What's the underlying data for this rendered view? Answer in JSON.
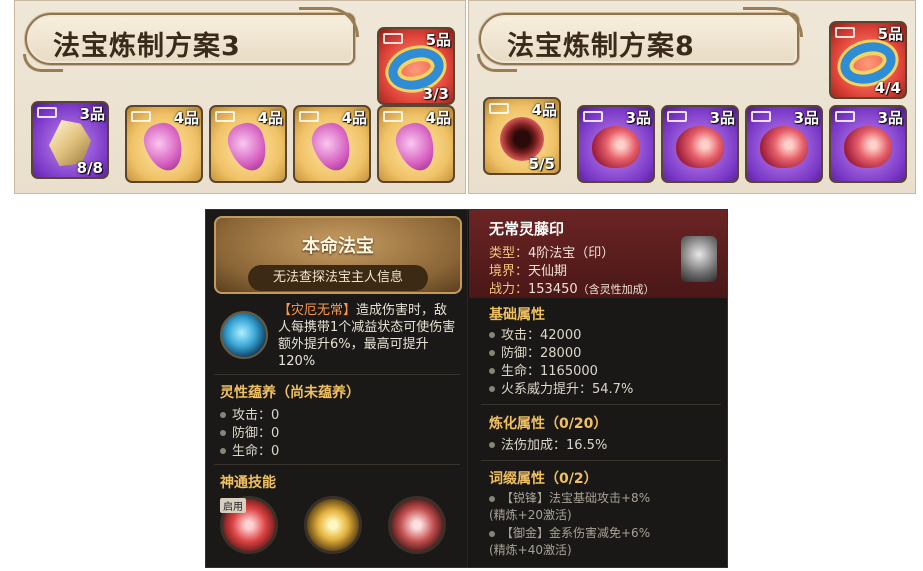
{
  "recipes": [
    {
      "title": "法宝炼制方案3",
      "main": {
        "grade": "5品",
        "count": "3/3",
        "icon": "ring-icon",
        "color": "red"
      },
      "materials": [
        {
          "grade": "3品",
          "count": "8/8",
          "icon": "crystal-icon",
          "color": "purple"
        },
        {
          "grade": "4品",
          "count": "",
          "icon": "pink-gem-icon",
          "color": "gold"
        },
        {
          "grade": "4品",
          "count": "",
          "icon": "pink-gem-icon",
          "color": "gold"
        },
        {
          "grade": "4品",
          "count": "",
          "icon": "pink-gem-icon",
          "color": "gold"
        },
        {
          "grade": "4品",
          "count": "",
          "icon": "pink-gem-icon",
          "color": "gold"
        }
      ]
    },
    {
      "title": "法宝炼制方案8",
      "main": {
        "grade": "5品",
        "count": "4/4",
        "icon": "ring-icon",
        "color": "red"
      },
      "materials": [
        {
          "grade": "4品",
          "count": "5/5",
          "icon": "seal-icon",
          "color": "gold"
        },
        {
          "grade": "3品",
          "count": "",
          "icon": "shell-icon",
          "color": "purple"
        },
        {
          "grade": "3品",
          "count": "",
          "icon": "shell-icon",
          "color": "purple"
        },
        {
          "grade": "3品",
          "count": "",
          "icon": "shell-icon",
          "color": "purple"
        },
        {
          "grade": "3品",
          "count": "",
          "icon": "shell-icon",
          "color": "purple"
        }
      ]
    }
  ],
  "tooltip": {
    "left": {
      "title": "本命法宝",
      "subtitle": "无法查探法宝主人信息",
      "skill_name": "【灾厄无常】",
      "skill_desc": "造成伤害时，敌人每携带1个减益状态可使伤害额外提升6%，最高可提升120%",
      "spirit_title": "灵性蕴养（尚未蕴养）",
      "spirit_attrs": [
        "攻击：0",
        "防御：0",
        "生命：0"
      ],
      "skills_title": "神通技能",
      "enabled_badge": "启用"
    },
    "right": {
      "name": "无常灵藤印",
      "type_label": "类型：",
      "type_value": "4阶法宝（印）",
      "realm_label": "境界：",
      "realm_value": "天仙期",
      "power_label": "战力：",
      "power_value": "153450",
      "power_note": "（含灵性加成）",
      "base_title": "基础属性",
      "base_attrs": [
        "攻击：42000",
        "防御：28000",
        "生命：1165000",
        "火系威力提升：54.7%"
      ],
      "refine_title": "炼化属性（0/20）",
      "refine_attrs": [
        "法伤加成：16.5%"
      ],
      "affix_title": "词缀属性（0/2）",
      "affixes": [
        {
          "line1": "【锐锋】法宝基础攻击+8%",
          "line2": "(精炼+20激活)"
        },
        {
          "line1": "【御金】金系伤害减免+6%",
          "line2": "(精炼+40激活)"
        }
      ]
    }
  },
  "colors": {
    "gold_text": "#f0c060",
    "highlight": "#ff9a4a",
    "tooltip_bg": "#161412"
  }
}
